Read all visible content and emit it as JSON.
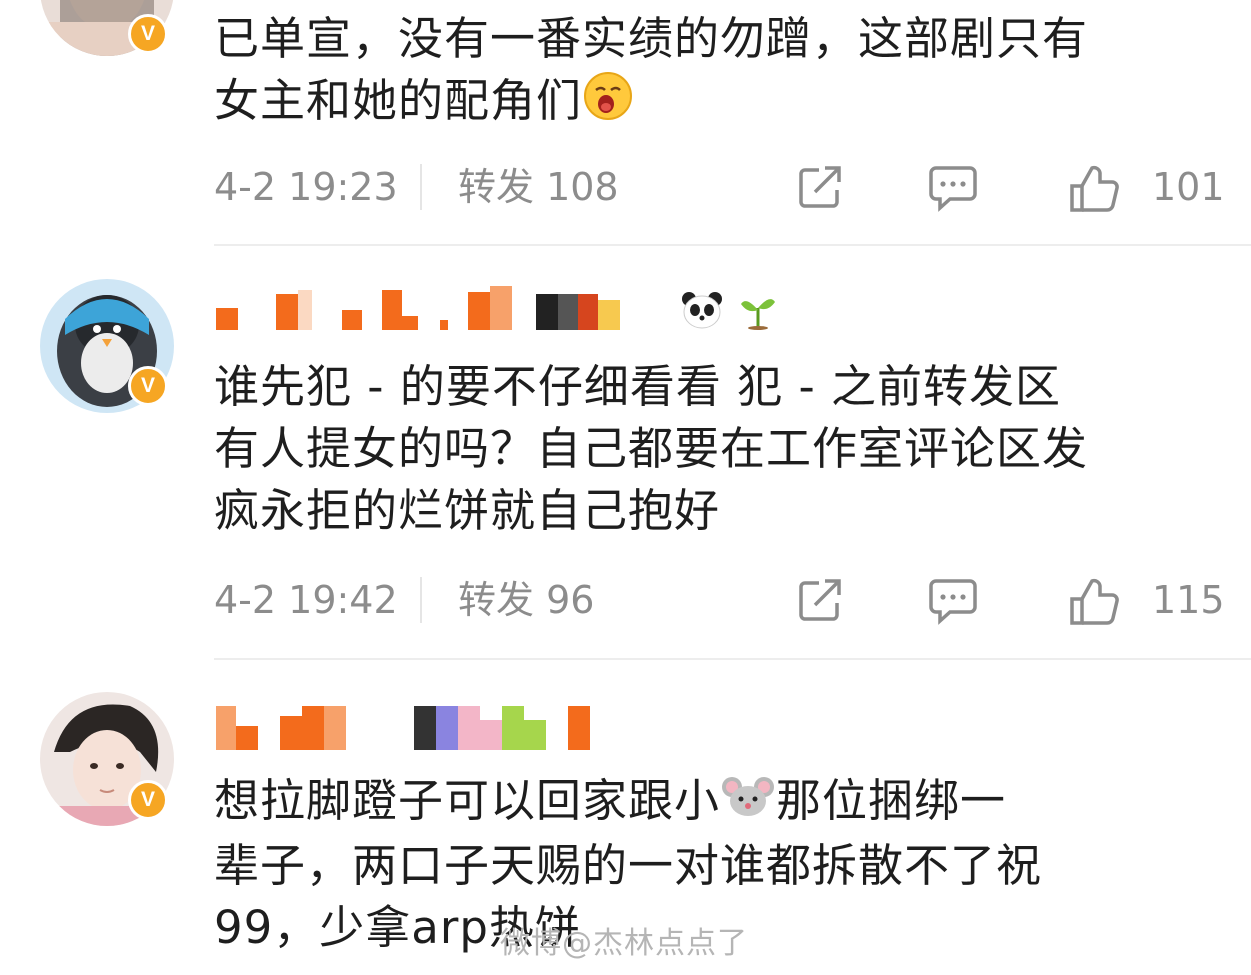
{
  "comments": [
    {
      "text_line1": "已单宣，没有一番实绩的勿蹭，这部剧只有",
      "text_line2": "女主和她的配角们",
      "emoji": "yawn-emoji",
      "time": "4-2 19:23",
      "forward": "转发 108",
      "likes": "101"
    },
    {
      "text_line1": "谁先犯 - 的要不仔细看看 犯 - 之前转发区",
      "text_line2": "有人提女的吗？自己都要在工作室评论区发",
      "text_line3": "疯永拒的烂饼就自己抱好",
      "badges": [
        "panda-emoji",
        "sprout-emoji"
      ],
      "time": "4-2 19:42",
      "forward": "转发 96",
      "likes": "115"
    },
    {
      "text_part1": "想拉脚蹬子可以回家跟小",
      "emoji": "mouse-emoji",
      "text_part2": "那位捆绑一",
      "text_line2": "辈子，两口子天赐的一对谁都拆散不了祝",
      "text_line3": "99，少拿arp热饼"
    }
  ],
  "watermark": "微博@杰林点点了",
  "colors": {
    "verified_badge": "#f6a623",
    "meta_text": "#8c8c8c",
    "username_mosaic": "#f36b1c"
  },
  "icons": [
    "share-icon",
    "comment-icon",
    "like-icon"
  ]
}
